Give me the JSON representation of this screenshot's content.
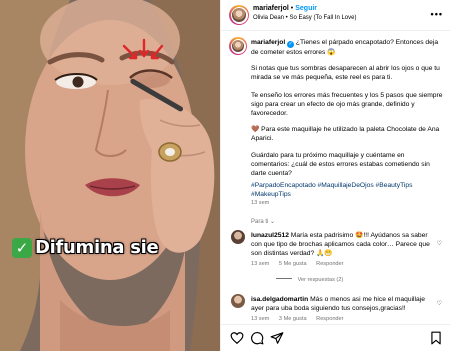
{
  "video": {
    "caption": "Difumina sie",
    "check_glyph": "✓"
  },
  "post": {
    "username": "mariaferjol",
    "follow_label": "Seguir",
    "audio": "Olivia Dean • So Easy (To Fall In Love)",
    "more": "•••",
    "caption_p1": "¿Tienes el párpado encapotado? Entonces deja de cometer estos errores 😱",
    "caption_p2": "Si notas que tus sombras desaparecen al abrir los ojos o que tu mirada se ve más pequeña, este reel es para ti.",
    "caption_p3": "Te enseño los errores más frecuentes y los 5 pasos que siempre sigo para crear un efecto de ojo más grande, definido y favorecedor.",
    "caption_p4": "🤎 Para este maquillaje he utilizado la paleta Chocolate de Ana Aparici.",
    "caption_p5": "Guárdalo para tu próximo maquillaje y cuéntame en comentarios: ¿cuál de estos errores estabas cometiendo sin darte cuenta?",
    "hashtags": "#ParpadoEncapotado #MaquillajeDeOjos #BeautyTips #MakeupTips",
    "time": "13 sem",
    "translate_label": "Para ti",
    "translate_chevron": "⌄"
  },
  "comments": [
    {
      "username": "lunazul2512",
      "text": "María esta padrisimo 🤩!!! Ayúdanos sa saber con que tipo de brochas aplicamos cada color… Parece que son distintas verdad? 🙏😁",
      "time": "13 sem",
      "likes": "5 Me gusta",
      "reply": "Responder",
      "view_replies": "Ver respuestas (2)"
    },
    {
      "username": "isa.delgadomartin",
      "text": "Más o menos asi me hice el maquillaje ayer para uba boda siguiendo tus consejos,gracias!!",
      "time": "13 sem",
      "likes": "3 Me gusta",
      "reply": "Responder"
    }
  ],
  "colors": {
    "link_blue": "#0095f6",
    "hashtag": "#00376b",
    "muted": "#737373",
    "caption_check": "#3aa845"
  }
}
